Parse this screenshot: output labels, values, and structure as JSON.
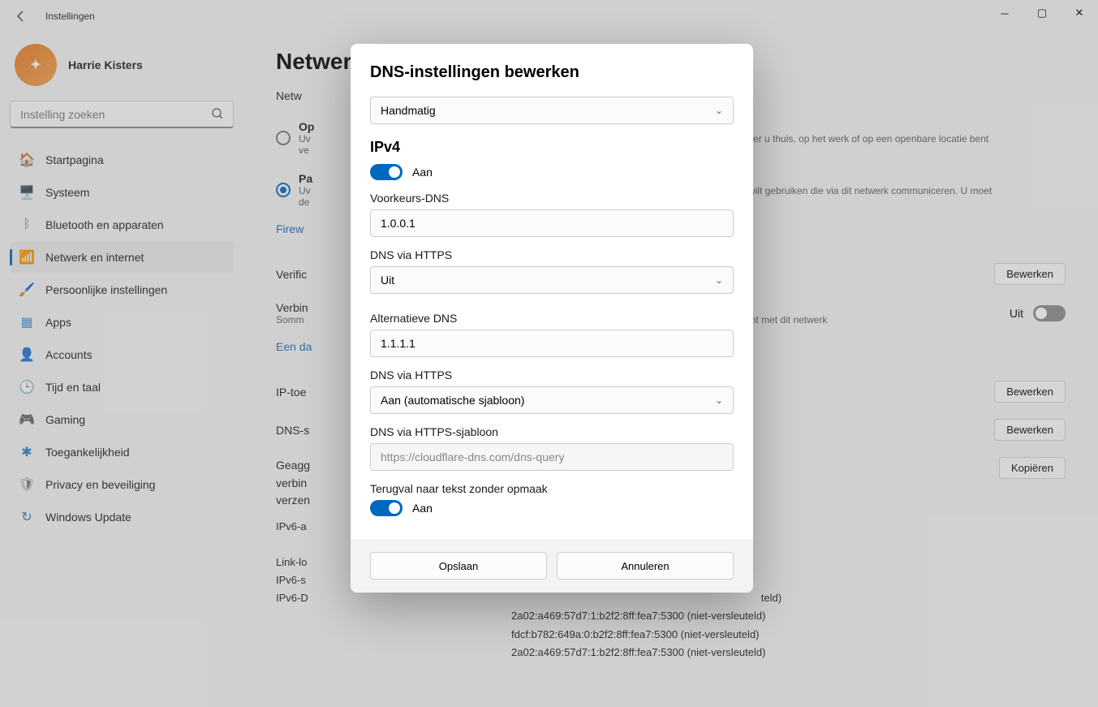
{
  "window": {
    "title": "Instellingen"
  },
  "profile": {
    "name": "Harrie Kisters"
  },
  "search": {
    "placeholder": "Instelling zoeken"
  },
  "nav": [
    {
      "icon": "🏠",
      "label": "Startpagina",
      "color": "#d98a2b"
    },
    {
      "icon": "🖥️",
      "label": "Systeem",
      "color": "#3a8dde"
    },
    {
      "icon": "ᛒ",
      "label": "Bluetooth en apparaten",
      "color": "#3a8dde"
    },
    {
      "icon": "📶",
      "label": "Netwerk en internet",
      "color": "#2aa3b7",
      "active": true
    },
    {
      "icon": "🖌️",
      "label": "Persoonlijke instellingen",
      "color": "#c97a3a"
    },
    {
      "icon": "▦",
      "label": "Apps",
      "color": "#3a8dde"
    },
    {
      "icon": "👤",
      "label": "Accounts",
      "color": "#3aa36a"
    },
    {
      "icon": "🕒",
      "label": "Tijd en taal",
      "color": "#3a8dde"
    },
    {
      "icon": "🎮",
      "label": "Gaming",
      "color": "#777"
    },
    {
      "icon": "✱",
      "label": "Toegankelijkheid",
      "color": "#2a7abf"
    },
    {
      "icon": "🛡",
      "label": "Privacy en beveiliging",
      "color": "#777"
    },
    {
      "icon": "↻",
      "label": "Windows Update",
      "color": "#2a7abf"
    }
  ],
  "page": {
    "title": "Netwerk",
    "np_label": "Netw",
    "opt1_label": "Op",
    "opt1_sub1": "Uv",
    "opt1_sub2": "ve",
    "opt1_right": "wanneer u thuis, op het werk of op een openbare locatie bent",
    "opt2_label": "Pa",
    "opt2_sub1": "Uv",
    "opt2_sub2": "de",
    "opt2_right": "apps wilt gebruiken die via dit netwerk communiceren. U moet",
    "firewall_link": "Firew",
    "verify_label": "Verific",
    "edit_btn": "Bewerken",
    "connect_label": "Verbin",
    "connect_sub": "Somm",
    "connect_right": "onden bent met dit netwerk",
    "uit_label": "Uit",
    "data_link": "Een da",
    "ip_label": "IP-toe",
    "dns_label": "DNS-s",
    "agg_l1": "Geagg",
    "agg_l2": "verbin",
    "agg_l3": "verzen",
    "copy_btn": "Kopiëren",
    "info_rows": [
      "IPv6-a",
      "Link-lo",
      "IPv6-s",
      "IPv6-D"
    ],
    "dns_lines": [
      "teld)",
      "2a02:a469:57d7:1:b2f2:8ff:fea7:5300 (niet-versleuteld)",
      "fdcf:b782:649a:0:b2f2:8ff:fea7:5300 (niet-versleuteld)",
      "2a02:a469:57d7:1:b2f2:8ff:fea7:5300 (niet-versleuteld)"
    ]
  },
  "dialog": {
    "title": "DNS-instellingen bewerken",
    "mode": "Handmatig",
    "ipv4_title": "IPv4",
    "ipv4_toggle": "Aan",
    "pref_dns_label": "Voorkeurs-DNS",
    "pref_dns_value": "1.0.0.1",
    "doh_label": "DNS via HTTPS",
    "doh_pref_value": "Uit",
    "alt_dns_label": "Alternatieve DNS",
    "alt_dns_value": "1.1.1.1",
    "doh_alt_value": "Aan (automatische sjabloon)",
    "doh_tpl_label": "DNS via HTTPS-sjabloon",
    "doh_tpl_value": "https://cloudflare-dns.com/dns-query",
    "fallback_label": "Terugval naar tekst zonder opmaak",
    "fallback_toggle": "Aan",
    "save": "Opslaan",
    "cancel": "Annuleren"
  }
}
